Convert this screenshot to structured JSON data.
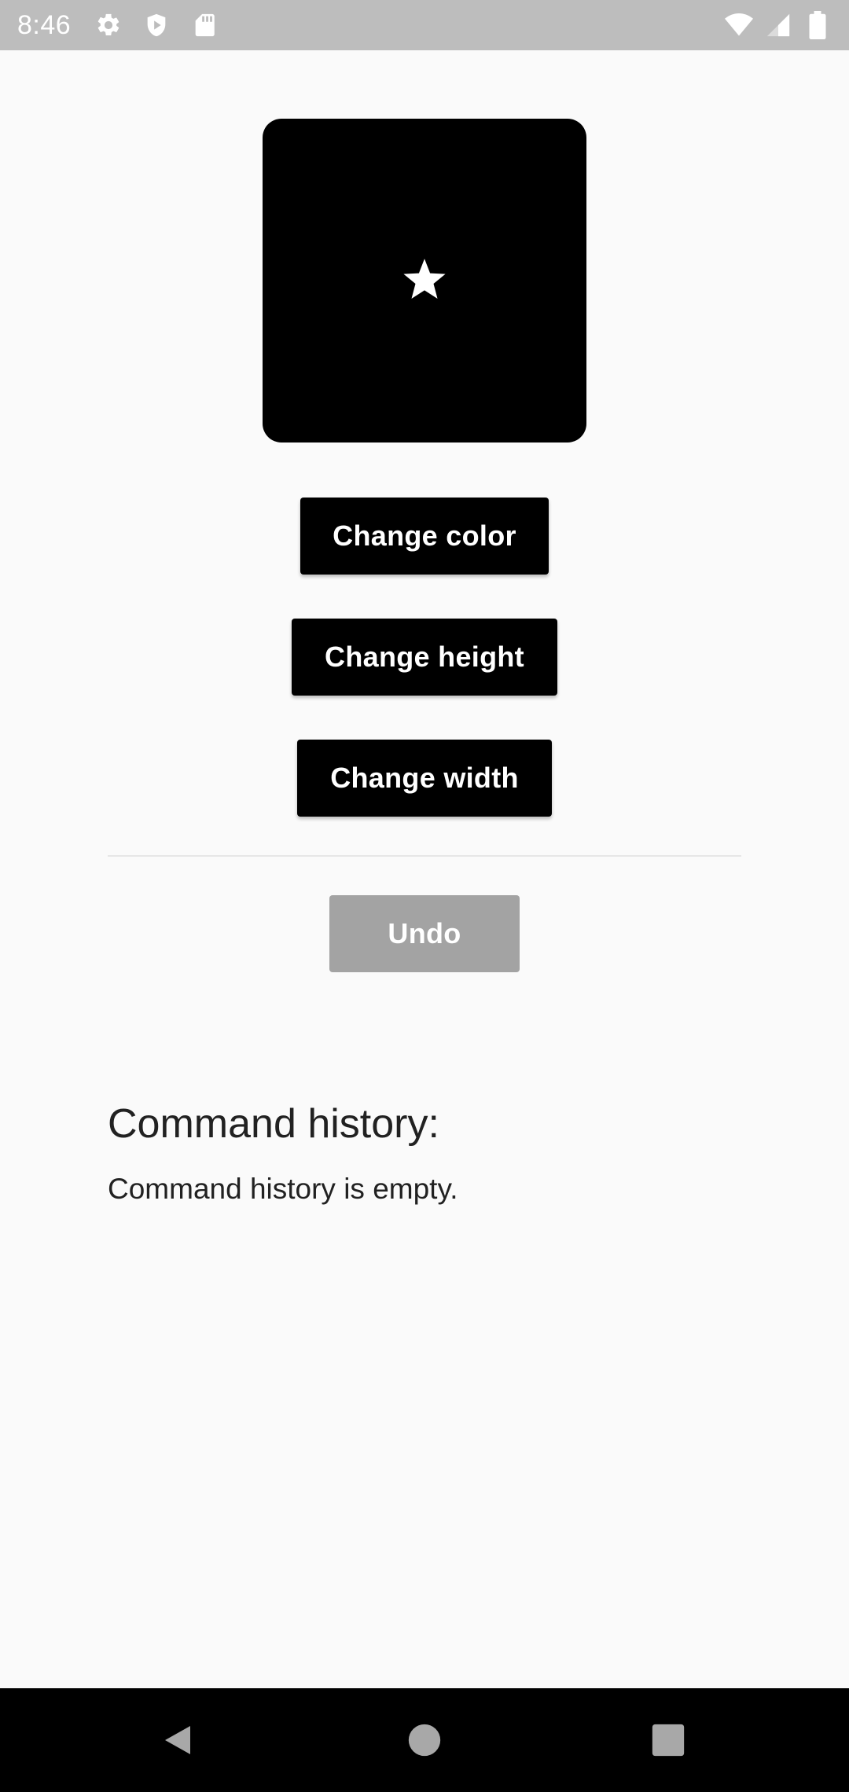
{
  "status_bar": {
    "time": "8:46",
    "left_icons": [
      "gear-icon",
      "shield-play-icon",
      "sd-card-icon"
    ],
    "right_icons": [
      "wifi-icon",
      "signal-icon",
      "battery-icon"
    ]
  },
  "preview": {
    "icon": "star-icon",
    "box_color": "#000000",
    "icon_color": "#ffffff"
  },
  "buttons": {
    "change_color": "Change color",
    "change_height": "Change height",
    "change_width": "Change width",
    "undo": "Undo"
  },
  "history": {
    "title": "Command history:",
    "empty_message": "Command history is empty."
  },
  "colors": {
    "status_bar": "#bdbdbd",
    "background": "#fafafa",
    "button": "#000000",
    "button_disabled": "#a3a3a3",
    "nav_bar": "#000000"
  },
  "nav_bar": {
    "icons": [
      "back-icon",
      "home-icon",
      "recents-icon"
    ]
  }
}
